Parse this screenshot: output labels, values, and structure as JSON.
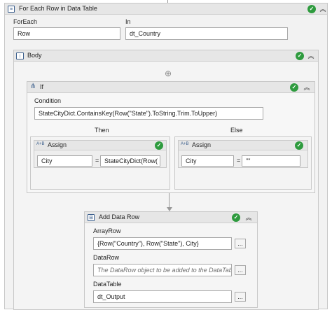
{
  "foreach_activity": {
    "title": "For Each Row in Data Table",
    "foreach_label": "ForEach",
    "foreach_value": "Row",
    "in_label": "In",
    "in_value": "dt_Country"
  },
  "body": {
    "title": "Body",
    "add_glyph": "⊕"
  },
  "if_activity": {
    "title": "If",
    "condition_label": "Condition",
    "condition_value": "StateCityDict.ContainsKey(Row(\"State\").ToString.Trim.ToUpper)",
    "then_label": "Then",
    "else_label": "Else"
  },
  "then_assign": {
    "title": "Assign",
    "icon_text": "A+B",
    "to_value": "City",
    "equals": "=",
    "value": "StateCityDict(Row("
  },
  "else_assign": {
    "title": "Assign",
    "icon_text": "A+B",
    "to_value": "City",
    "equals": "=",
    "value": "\"\""
  },
  "add_data_row": {
    "title": "Add Data Row",
    "arrayrow_label": "ArrayRow",
    "arrayrow_value": "{Row(\"Country\"), Row(\"State\"), City}",
    "datarow_label": "DataRow",
    "datarow_placeholder": "The DataRow object to be added to the DataTable.",
    "datatable_label": "DataTable",
    "datatable_value": "dt_Output",
    "browse_label": "..."
  },
  "icons": {
    "check": "✓",
    "collapse": "︽"
  },
  "colors": {
    "success": "#2e9b3e",
    "icon_blue": "#3a5e8c"
  }
}
